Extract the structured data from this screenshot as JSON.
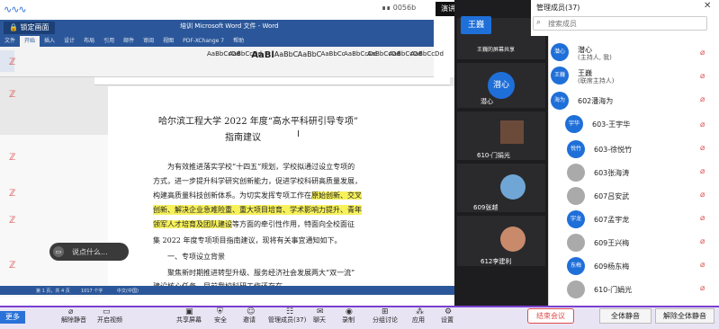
{
  "meeting": {
    "brand": "∿∿∿",
    "signal_text": "∎∎ 0056b",
    "presenter_view_label": "演讲者视图",
    "lock_screen_label": "锁定画面"
  },
  "word": {
    "window_title": "培训 Microsoft Word 文件 - Word",
    "tabs": [
      "文件",
      "开始",
      "插入",
      "设计",
      "布局",
      "引用",
      "邮件",
      "审阅",
      "视图",
      "PDF-XChange 7",
      "帮助"
    ],
    "styles": [
      "AaBbCcDd",
      "AaBbCcDd",
      "AaBl",
      "AaBbC",
      "AaBbC",
      "AaBbCc",
      "AaBbCcDd",
      "AaBbCcDd",
      "AaBbCcDd",
      "AaBbCcDd"
    ],
    "doc_title": "哈尔滨工程大学 2022 年度“高水平科研引导专项”",
    "doc_subtitle": "指南建议",
    "paragraphs": [
      "为有效推进落实学校“十四五”规划，学校拟通过设立专项的",
      "方式，进一步提升科学研究创新能力，促进学校科研高质量发展，",
      "构建高质量科技创新体系。为切实发挥专项工作在",
      "创新、解决企业急难险重、重大项目培育、学术影响力提升、青年",
      "领军人才培育及团队建设等方面的牵引性作用，特面向全校面征",
      "集 2022 年度专项项目指南建议，现将有关事宜通知如下。",
      "一、专项设立背景",
      "聚焦新时期推进转型升级、服务经济社会发展两大“双一流”",
      "建设核心任务，目前我校科研工作还存在..."
    ],
    "highlight_inline": "原始创新、交叉",
    "highlight_line1": "创新、解决企业急难险重、重大项目培育、学术影响力提升、青年",
    "highlight_line2a": "领军人才培育及团队建设",
    "line2b": "等方面的牵引性作用，特面向全校面征",
    "statusbar": [
      "第 1 页，共 4 页",
      "1017 个字",
      "中文(中国)"
    ]
  },
  "chat": {
    "placeholder": "说点什么..."
  },
  "video": {
    "tiles": [
      {
        "name": "王巍的屏幕共享",
        "avatar": "王巍"
      },
      {
        "name": "潜心",
        "avatar": "潜心"
      },
      {
        "name": "610-门娟光",
        "avatar": ""
      },
      {
        "name": "609张越",
        "avatar": ""
      },
      {
        "name": "612李建利",
        "avatar": ""
      }
    ]
  },
  "members_panel": {
    "title": "管理成员(37)",
    "search_placeholder": "搜索成员",
    "members": [
      {
        "avatar": "潜心",
        "name": "潜心",
        "role": "(主持人, 我)"
      },
      {
        "avatar": "王巍",
        "name": "王巍",
        "role": "(联席主持人)"
      },
      {
        "avatar": "海为",
        "name": "602潘海为",
        "role": ""
      },
      {
        "avatar": "宇华",
        "name": "603-王宇华",
        "role": ""
      },
      {
        "avatar": "悦竹",
        "name": "603-徐悦竹",
        "role": ""
      },
      {
        "avatar": "",
        "name": "603张海涛",
        "role": ""
      },
      {
        "avatar": "",
        "name": "607吕安武",
        "role": ""
      },
      {
        "avatar": "宇龙",
        "name": "607孟宇龙",
        "role": ""
      },
      {
        "avatar": "",
        "name": "609王兴梅",
        "role": ""
      },
      {
        "avatar": "东梅",
        "name": "609杨东梅",
        "role": ""
      },
      {
        "avatar": "",
        "name": "610-门娟光",
        "role": ""
      }
    ]
  },
  "toolbar": {
    "more": "更多",
    "mute": "解除静音",
    "video": "开启视频",
    "share": "共享屏幕",
    "security": "安全",
    "invite": "邀请",
    "members": "管理成员(37)",
    "chat": "聊天",
    "record": "录制",
    "breakout": "分组讨论",
    "apps": "应用",
    "settings": "设置",
    "end": "结束会议",
    "mute_all": "全体静音",
    "unmute_all": "解除全体静音"
  },
  "colors": {
    "word_blue": "#2b579a",
    "highlight": "#f7f15c",
    "accent_purple": "#7a3fd1",
    "avatar_blue": "#1f6fd8",
    "end_red": "#e04c4c"
  }
}
